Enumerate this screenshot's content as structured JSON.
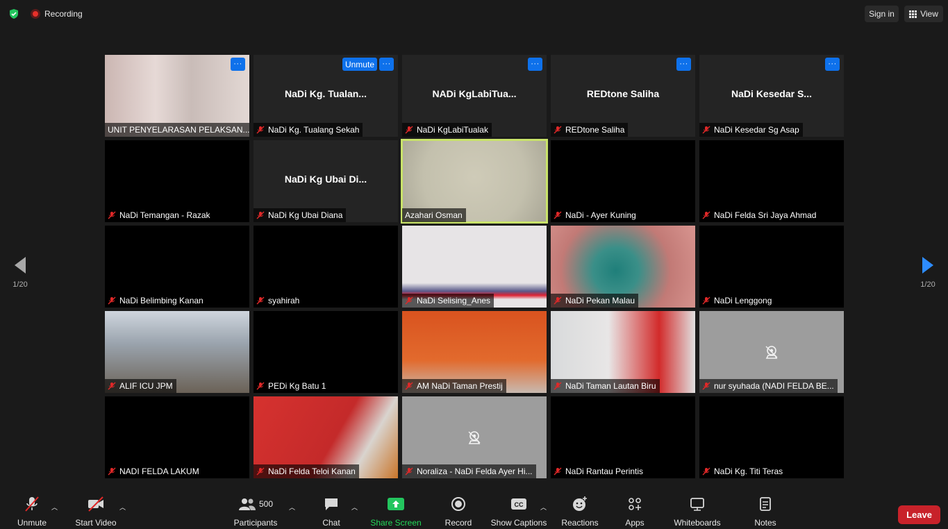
{
  "topbar": {
    "recording_label": "Recording",
    "signin_label": "Sign in",
    "view_label": "View"
  },
  "pagination": {
    "left": "1/20",
    "right": "1/20"
  },
  "tiles": [
    {
      "name": "UNIT PENYELARASAN PELAKSAN...",
      "video": true,
      "muted": false,
      "more": "···"
    },
    {
      "name": "NaDi Kg. Tualang Sekah",
      "big": "NaDi Kg. Tualan...",
      "muted": true,
      "more": "···",
      "unmute": "Unmute"
    },
    {
      "name": "NaDi KgLabiTualak",
      "big": "NADi KgLabiTua...",
      "muted": true,
      "more": "···"
    },
    {
      "name": "REDtone Saliha",
      "big": "REDtone Saliha",
      "muted": true,
      "more": "···"
    },
    {
      "name": "NaDi Kesedar Sg Asap",
      "big": "NaDi Kesedar S...",
      "muted": true,
      "more": "···"
    },
    {
      "name": "NaDi Temangan - Razak",
      "muted": true
    },
    {
      "name": "NaDi Kg Ubai Diana",
      "big": "NaDi Kg Ubai Di...",
      "muted": true
    },
    {
      "name": "Azahari Osman",
      "video": true,
      "muted": false,
      "active": true
    },
    {
      "name": "NaDi - Ayer Kuning",
      "muted": true
    },
    {
      "name": "NaDi Felda Sri Jaya Ahmad",
      "muted": true
    },
    {
      "name": "NaDi Belimbing Kanan",
      "muted": true
    },
    {
      "name": "syahirah",
      "muted": true
    },
    {
      "name": "NaDi Selising_Anes",
      "video": true,
      "muted": true
    },
    {
      "name": "NaDi Pekan Malau",
      "video": true,
      "muted": true
    },
    {
      "name": "NaDi Lenggong",
      "muted": true
    },
    {
      "name": "ALIF ICU JPM",
      "video": true,
      "muted": true
    },
    {
      "name": "PEDi Kg Batu 1",
      "muted": true
    },
    {
      "name": "AM NaDi Taman Prestij",
      "video": true,
      "muted": true
    },
    {
      "name": "NaDi Taman Lautan Biru",
      "video": true,
      "muted": true
    },
    {
      "name": "nur syuhada (NADI FELDA BE...",
      "muted": true,
      "camoff": true
    },
    {
      "name": "NADI FELDA LAKUM",
      "muted": true
    },
    {
      "name": "NaDi Felda Teloi Kanan",
      "video": true,
      "muted": true
    },
    {
      "name": "Noraliza - NaDi Felda Ayer Hi...",
      "muted": true,
      "camoff": true
    },
    {
      "name": "NaDi Rantau Perintis",
      "muted": true
    },
    {
      "name": "NaDi Kg. Titi Teras",
      "muted": true
    }
  ],
  "toolbar": {
    "unmute": "Unmute",
    "start_video": "Start Video",
    "participants": "Participants",
    "participants_count": "500",
    "chat": "Chat",
    "share_screen": "Share Screen",
    "record": "Record",
    "show_captions": "Show Captions",
    "reactions": "Reactions",
    "apps": "Apps",
    "whiteboards": "Whiteboards",
    "notes": "Notes",
    "leave": "Leave",
    "cc_badge": "CC"
  }
}
